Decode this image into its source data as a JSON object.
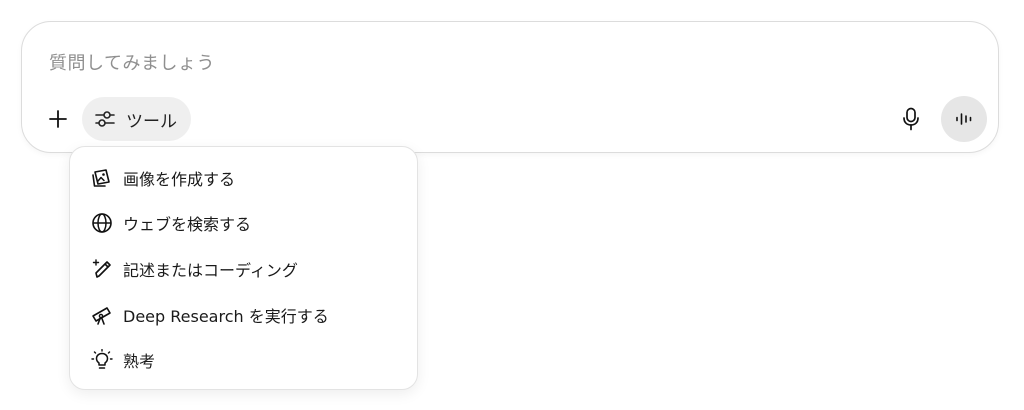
{
  "composer": {
    "placeholder": "質問してみましょう",
    "tools_label": "ツール"
  },
  "icons": {
    "plus": "plus-icon",
    "tools": "sliders-icon",
    "mic": "microphone-icon",
    "voice": "voice-waveform-icon"
  },
  "tools_menu": {
    "items": [
      {
        "label": "画像を作成する",
        "icon": "image-create-icon"
      },
      {
        "label": "ウェブを検索する",
        "icon": "globe-icon"
      },
      {
        "label": "記述またはコーディング",
        "icon": "pen-sparkle-icon"
      },
      {
        "label": "Deep Research を実行する",
        "icon": "telescope-icon"
      },
      {
        "label": "熟考",
        "icon": "lightbulb-icon"
      }
    ]
  }
}
